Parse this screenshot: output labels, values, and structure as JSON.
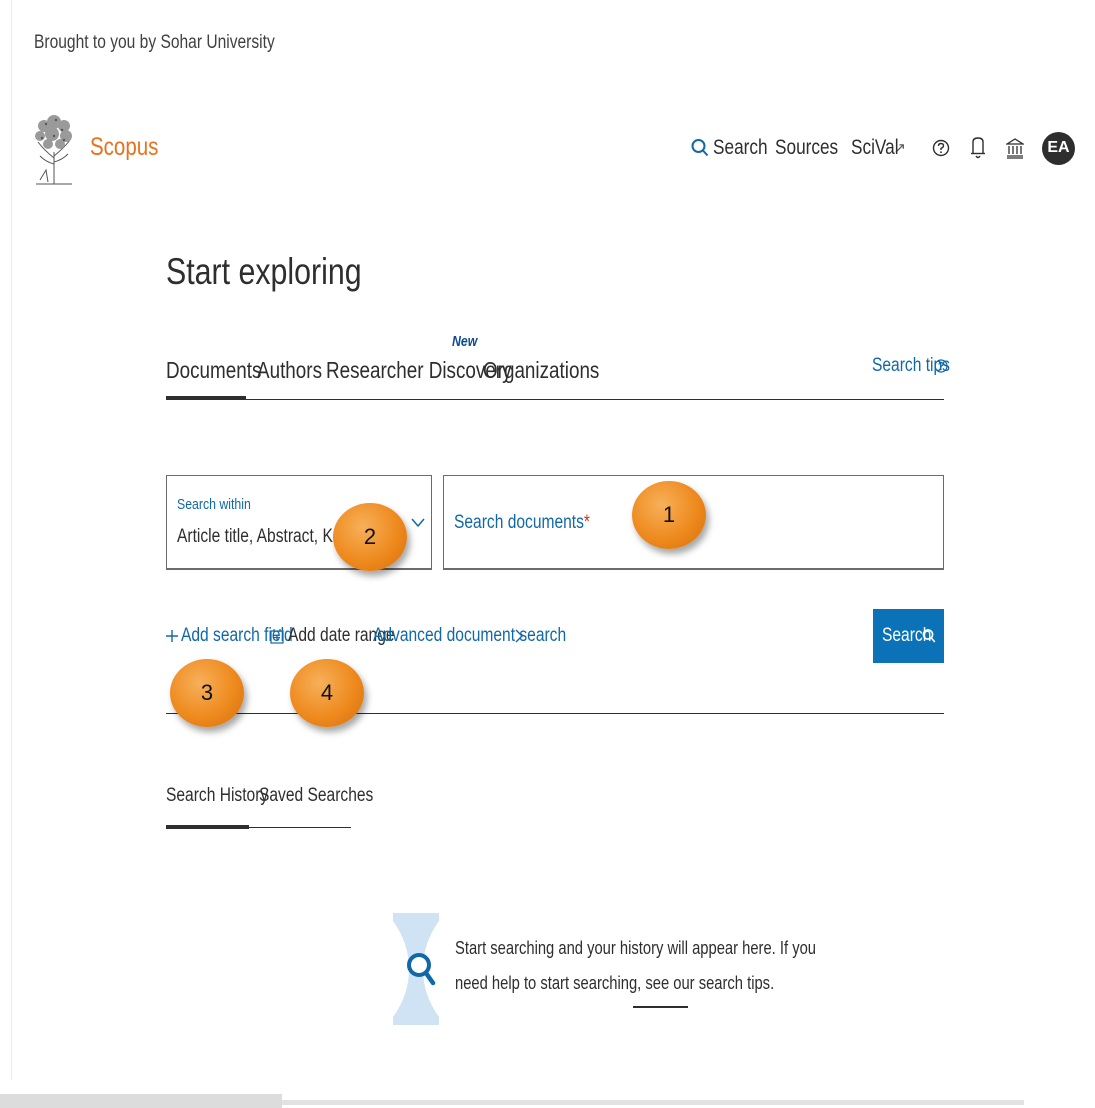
{
  "header": {
    "institution_line": "Brought to you by Sohar University",
    "brand": "Scopus",
    "nav": {
      "search": "Search",
      "sources": "Sources",
      "scival": "SciVal",
      "scival_ext": "↗",
      "avatar_initials": "EA"
    }
  },
  "main": {
    "title": "Start exploring",
    "tabs": [
      {
        "label": "Documents",
        "active": true
      },
      {
        "label": "Authors"
      },
      {
        "label": "Researcher Discovery",
        "badge": "New"
      },
      {
        "label": "Organizations"
      }
    ],
    "search_tips": "Search tips",
    "search_within": {
      "label": "Search within",
      "value": "Article title, Abstract, Keywords"
    },
    "search_field": {
      "placeholder": "Search documents",
      "required_mark": "*"
    },
    "actions": {
      "add_search_field": "Add search field",
      "add_date_range": "Add date range",
      "advanced_search": "Advanced document search",
      "search_button": "Search"
    },
    "callouts": [
      "1",
      "2",
      "3",
      "4"
    ],
    "history_tabs": [
      {
        "label": "Search History",
        "active": true
      },
      {
        "label": "Saved Searches"
      }
    ],
    "empty_state": {
      "line1": "Start searching and your history will appear here. If you",
      "line2_prefix": "need help to start searching, see our ",
      "line2_link": "search tips",
      "line2_suffix": "."
    }
  },
  "colors": {
    "brand_orange": "#e9711c",
    "link_blue": "#1168a8",
    "button_blue": "#0b72b8",
    "callout_orange": "#ee8a1e",
    "text_dark": "#2e2e2e"
  },
  "icons": [
    "search-icon",
    "help-icon",
    "bell-icon",
    "institution-icon",
    "chevron-down-icon",
    "plus-icon",
    "calendar-icon",
    "chevron-right-icon",
    "external-link-icon"
  ]
}
